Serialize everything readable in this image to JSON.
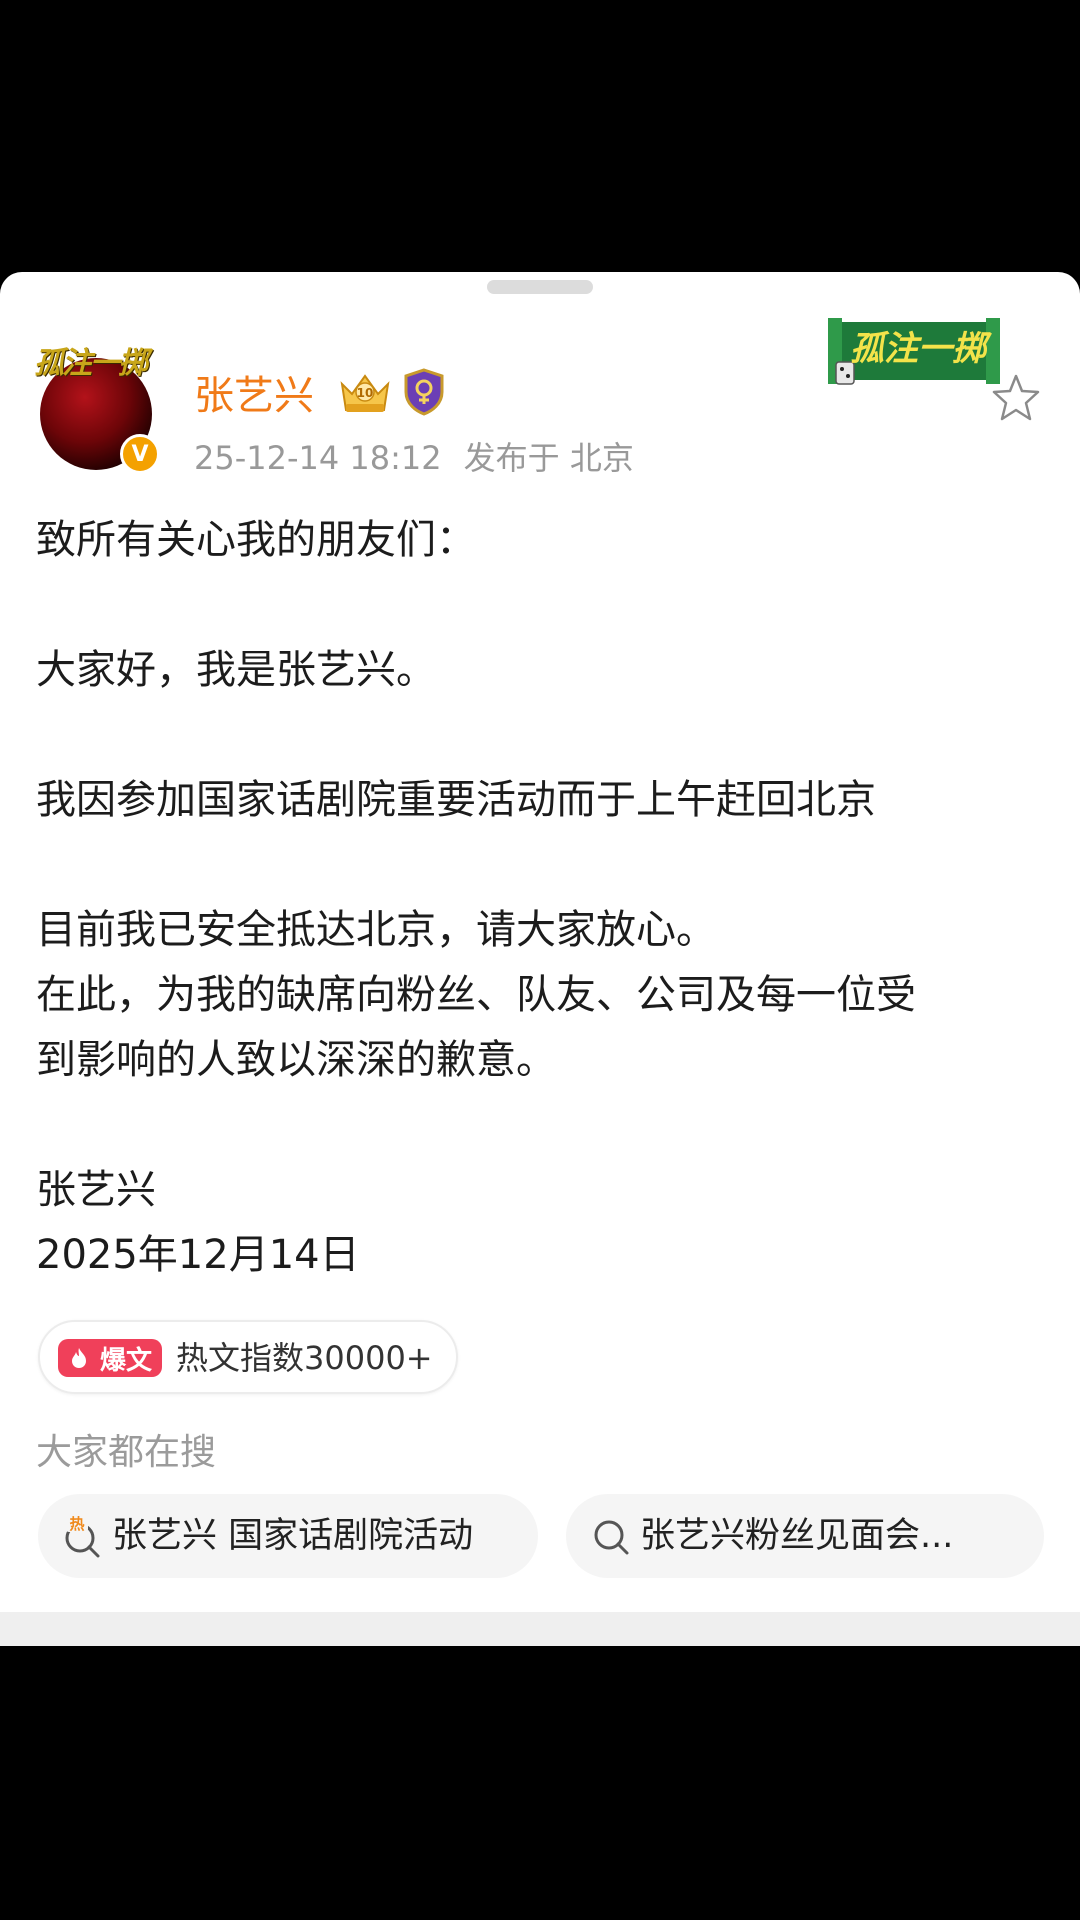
{
  "post": {
    "username": "张艺兴",
    "timestamp": "25-12-14 18:12",
    "location_label": "发布于 北京",
    "avatar_text": "孤注一掷",
    "stamp_text": "孤注一掷",
    "verified_mark": "V",
    "body": {
      "greeting": "致所有关心我的朋友们：",
      "line_1": "大家好，我是张艺兴。",
      "line_2": "我因参加国家话剧院重要活动而于上午赶回北京",
      "line_3": "目前我已安全抵达北京，请大家放心。",
      "line_4a": "在此，为我的缺席向粉丝、队友、公司及每一位受",
      "line_4b": "到影响的人致以深深的歉意。",
      "signature": "张艺兴",
      "date": "2025年12月14日"
    }
  },
  "hot_badge": {
    "tag": "爆文",
    "text": "热文指数30000+"
  },
  "related_search": {
    "heading": "大家都在搜",
    "items": [
      {
        "label": "张艺兴 国家话剧院活动",
        "icon": "hot-search-icon",
        "hot_mark": "热"
      },
      {
        "label": "张艺兴粉丝见面会...",
        "icon": "search-icon"
      }
    ]
  },
  "colors": {
    "username": "#f07a18",
    "hot_tag": "#f0405a",
    "meta_gray": "#999999",
    "verified": "#f4a100"
  }
}
